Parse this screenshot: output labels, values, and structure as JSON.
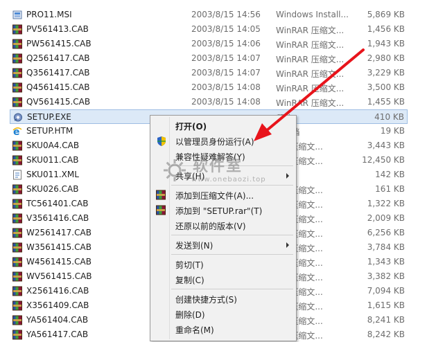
{
  "files": [
    {
      "name": "PRO11.MSI",
      "date": "2003/8/15 14:56",
      "type": "Windows Install...",
      "size": "5,869 KB",
      "icon": "msi-icon"
    },
    {
      "name": "PV561413.CAB",
      "date": "2003/8/15 14:05",
      "type": "WinRAR 压缩文...",
      "size": "1,456 KB",
      "icon": "rar-icon"
    },
    {
      "name": "PW561415.CAB",
      "date": "2003/8/15 14:06",
      "type": "WinRAR 压缩文...",
      "size": "1,943 KB",
      "icon": "rar-icon"
    },
    {
      "name": "Q2561417.CAB",
      "date": "2003/8/15 14:07",
      "type": "WinRAR 压缩文...",
      "size": "2,980 KB",
      "icon": "rar-icon"
    },
    {
      "name": "Q3561417.CAB",
      "date": "2003/8/15 14:07",
      "type": "WinRAR 压缩文...",
      "size": "3,229 KB",
      "icon": "rar-icon"
    },
    {
      "name": "Q4561415.CAB",
      "date": "2003/8/15 14:08",
      "type": "WinRAR 压缩文...",
      "size": "3,500 KB",
      "icon": "rar-icon"
    },
    {
      "name": "QV561415.CAB",
      "date": "2003/8/15 14:08",
      "type": "WinRAR 压缩文...",
      "size": "1,455 KB",
      "icon": "rar-icon"
    },
    {
      "name": "SETUP.EXE",
      "date": "",
      "type": "程序",
      "size": "410 KB",
      "icon": "exe-icon"
    },
    {
      "name": "SETUP.HTM",
      "date": "",
      "type": "L 文档",
      "size": "19 KB",
      "icon": "ie-icon"
    },
    {
      "name": "SKU0A4.CAB",
      "date": "",
      "type": "AR 压缩文...",
      "size": "3,443 KB",
      "icon": "rar-icon"
    },
    {
      "name": "SKU011.CAB",
      "date": "",
      "type": "AR 压缩文...",
      "size": "12,450 KB",
      "icon": "rar-icon"
    },
    {
      "name": "SKU011.XML",
      "date": "",
      "type": "文档",
      "size": "142 KB",
      "icon": "xml-icon"
    },
    {
      "name": "SKU026.CAB",
      "date": "",
      "type": "AR 压缩文...",
      "size": "161 KB",
      "icon": "rar-icon"
    },
    {
      "name": "TC561401.CAB",
      "date": "",
      "type": "AR 压缩文...",
      "size": "1,322 KB",
      "icon": "rar-icon"
    },
    {
      "name": "V3561416.CAB",
      "date": "",
      "type": "AR 压缩文...",
      "size": "2,009 KB",
      "icon": "rar-icon"
    },
    {
      "name": "W2561417.CAB",
      "date": "",
      "type": "AR 压缩文...",
      "size": "6,256 KB",
      "icon": "rar-icon"
    },
    {
      "name": "W3561415.CAB",
      "date": "",
      "type": "AR 压缩文...",
      "size": "3,784 KB",
      "icon": "rar-icon"
    },
    {
      "name": "W4561415.CAB",
      "date": "",
      "type": "AR 压缩文...",
      "size": "1,343 KB",
      "icon": "rar-icon"
    },
    {
      "name": "WV561415.CAB",
      "date": "",
      "type": "AR 压缩文...",
      "size": "3,382 KB",
      "icon": "rar-icon"
    },
    {
      "name": "X2561416.CAB",
      "date": "",
      "type": "AR 压缩文...",
      "size": "7,094 KB",
      "icon": "rar-icon"
    },
    {
      "name": "X3561409.CAB",
      "date": "",
      "type": "AR 压缩文...",
      "size": "1,615 KB",
      "icon": "rar-icon"
    },
    {
      "name": "YA561404.CAB",
      "date": "",
      "type": "AR 压缩文...",
      "size": "8,241 KB",
      "icon": "rar-icon"
    },
    {
      "name": "YA561417.CAB",
      "date": "",
      "type": "AR 压缩文...",
      "size": "8,242 KB",
      "icon": "rar-icon"
    }
  ],
  "selected_index": 7,
  "context_menu": {
    "items": [
      {
        "label": "打开(O)",
        "bold": true,
        "icon": "",
        "submenu": false
      },
      {
        "label": "以管理员身份运行(A)",
        "bold": false,
        "icon": "uac-shield-icon",
        "submenu": false
      },
      {
        "label": "兼容性疑难解答(Y)",
        "bold": false,
        "icon": "",
        "submenu": false
      },
      {
        "sep": true
      },
      {
        "label": "共享(H)",
        "bold": false,
        "icon": "",
        "submenu": true
      },
      {
        "sep": true
      },
      {
        "label": "添加到压缩文件(A)...",
        "bold": false,
        "icon": "rar-icon",
        "submenu": false
      },
      {
        "label": "添加到 \"SETUP.rar\"(T)",
        "bold": false,
        "icon": "rar-icon",
        "submenu": false
      },
      {
        "label": "还原以前的版本(V)",
        "bold": false,
        "icon": "",
        "submenu": false
      },
      {
        "sep": true
      },
      {
        "label": "发送到(N)",
        "bold": false,
        "icon": "",
        "submenu": true
      },
      {
        "sep": true
      },
      {
        "label": "剪切(T)",
        "bold": false,
        "icon": "",
        "submenu": false
      },
      {
        "label": "复制(C)",
        "bold": false,
        "icon": "",
        "submenu": false
      },
      {
        "sep": true
      },
      {
        "label": "创建快捷方式(S)",
        "bold": false,
        "icon": "",
        "submenu": false
      },
      {
        "label": "删除(D)",
        "bold": false,
        "icon": "",
        "submenu": false
      },
      {
        "label": "重命名(M)",
        "bold": false,
        "icon": "",
        "submenu": false
      }
    ]
  },
  "watermark": {
    "text": "软件室",
    "url": "www.onebaozi.top"
  },
  "colors": {
    "arrow": "#e8141b",
    "selection": "#dce9f7"
  }
}
